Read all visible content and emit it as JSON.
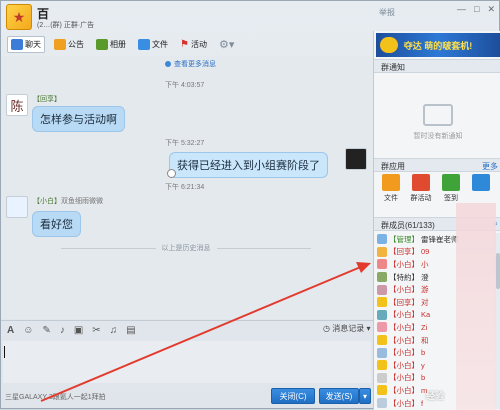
{
  "window": {
    "group_name": "百",
    "group_sub": "(2…(群) 正群·广告",
    "controls": [
      "—",
      "□",
      "✕"
    ],
    "top_right": "举报"
  },
  "toolbar": {
    "items": [
      {
        "label": "聊天",
        "icon": "chat-icon",
        "color": "#3b7dd8",
        "active": true
      },
      {
        "label": "公告",
        "icon": "notice-icon",
        "color": "#f0a020"
      },
      {
        "label": "相册",
        "icon": "album-icon",
        "color": "#5a9a2a"
      },
      {
        "label": "文件",
        "icon": "folder-icon",
        "color": "#3a8ee2"
      },
      {
        "label": "活动",
        "icon": "flag-icon",
        "color": "#d8332b"
      },
      {
        "label": "",
        "icon": "gear-icon",
        "color": "#7f8c99"
      }
    ]
  },
  "chat": {
    "more_messages": "查看更多消息",
    "messages": [
      {
        "time": "下午 4:03:57",
        "sender_role": "【回享】",
        "sender_name": "",
        "avatar_char": "陈",
        "text": "怎样参与活动啊",
        "mine": false
      },
      {
        "time": "下午 5:32:27",
        "text": "获得已经进入到小组赛阶段了",
        "mine": true
      },
      {
        "time": "下午 6:21:34",
        "sender_role": "【小白】",
        "sender_name": "双鱼细雨微微",
        "avatar_char": "",
        "text": "看好您",
        "mine": false
      }
    ],
    "history_separator": "以上是历史消息"
  },
  "input": {
    "history_label": "消息记录",
    "tool_icons": [
      "font-icon",
      "emoji-icon",
      "shake-icon",
      "mic-icon",
      "picture-icon",
      "screenshot-icon",
      "music-icon",
      "more-icon"
    ]
  },
  "footer": {
    "ad_text": "三星GALAXY 3跟氦人一起1拜拍",
    "close_label": "关闭(C)",
    "send_label": "发送(S)"
  },
  "right_panel": {
    "banner_text": "夺达 萌的啵套机!",
    "notice_header": "群通知",
    "notice_empty": "暂时没有新通知",
    "apps_header": "群应用",
    "apps_more": "更多",
    "apps": [
      {
        "label": "文件",
        "color": "#f29a1e"
      },
      {
        "label": "群活动",
        "color": "#e04a2f"
      },
      {
        "label": "签到",
        "color": "#3fa33a"
      },
      {
        "label": "",
        "color": "#2e8ad8"
      }
    ],
    "members_header": "群成员(61/133)",
    "members": [
      {
        "role": "【管理】",
        "name": "雷锋崔老师"
      },
      {
        "role": "【回享】",
        "name": "09"
      },
      {
        "role": "【小白】",
        "name": "小"
      },
      {
        "role": "【特約】",
        "name": "澄"
      },
      {
        "role": "【小白】",
        "name": "游"
      },
      {
        "role": "【回享】",
        "name": "对"
      },
      {
        "role": "【小白】",
        "name": "Ka"
      },
      {
        "role": "【小白】",
        "name": "Zi"
      },
      {
        "role": "【小白】",
        "name": "和"
      },
      {
        "role": "【小白】",
        "name": "b"
      },
      {
        "role": "【小白】",
        "name": "y"
      },
      {
        "role": "【小白】",
        "name": "b"
      },
      {
        "role": "【小白】",
        "name": "m"
      },
      {
        "role": "【小白】",
        "name": "f"
      }
    ]
  },
  "watermark": "经验"
}
